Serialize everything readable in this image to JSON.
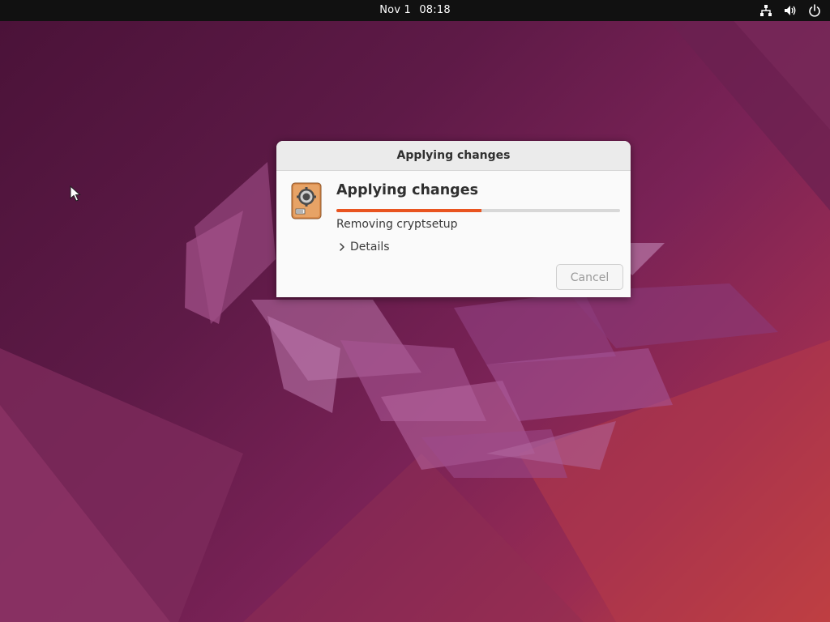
{
  "topbar": {
    "date": "Nov 1",
    "time": "08:18",
    "tray_icons": [
      "network-icon",
      "volume-icon",
      "power-icon"
    ]
  },
  "dialog": {
    "window_title": "Applying changes",
    "heading": "Applying changes",
    "progress_fraction": 0.51,
    "status": "Removing cryptsetup",
    "details_label": "Details",
    "details_expanded": false,
    "cancel_label": "Cancel",
    "cancel_enabled": false,
    "icon": "software-package-icon"
  },
  "colors": {
    "accent": "#e95420",
    "topbar": "#111111",
    "dialog_bg": "#fafafa"
  }
}
